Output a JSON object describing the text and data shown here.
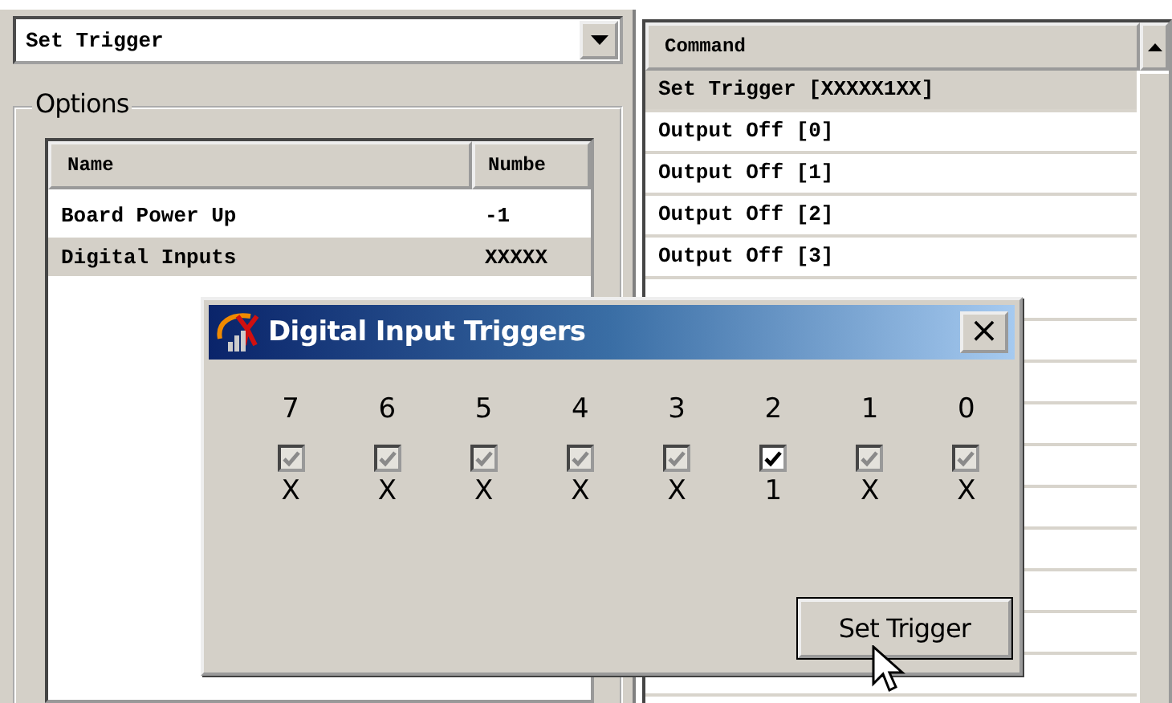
{
  "command_combo": {
    "value": "Set Trigger"
  },
  "options": {
    "title": "Options",
    "columns": [
      "Name",
      "Numbe"
    ],
    "rows": [
      {
        "name": "Board Power Up",
        "number": "-1",
        "selected": false
      },
      {
        "name": "Digital Inputs",
        "number": "XXXXX",
        "selected": true
      }
    ]
  },
  "command_list": {
    "column": "Command",
    "rows": [
      {
        "text": "Set Trigger [XXXXX1XX]",
        "selected": true
      },
      {
        "text": "Output Off [0]",
        "selected": false
      },
      {
        "text": "Output Off [1]",
        "selected": false
      },
      {
        "text": "Output Off [2]",
        "selected": false
      },
      {
        "text": "Output Off [3]",
        "selected": false
      }
    ]
  },
  "dialog": {
    "title": "Digital Input Triggers",
    "close": "×",
    "bits": [
      {
        "label": "7",
        "checked": true,
        "disabled": true,
        "value": "X"
      },
      {
        "label": "6",
        "checked": true,
        "disabled": true,
        "value": "X"
      },
      {
        "label": "5",
        "checked": true,
        "disabled": true,
        "value": "X"
      },
      {
        "label": "4",
        "checked": true,
        "disabled": true,
        "value": "X"
      },
      {
        "label": "3",
        "checked": true,
        "disabled": true,
        "value": "X"
      },
      {
        "label": "2",
        "checked": true,
        "disabled": false,
        "value": "1"
      },
      {
        "label": "1",
        "checked": true,
        "disabled": true,
        "value": "X"
      },
      {
        "label": "0",
        "checked": true,
        "disabled": true,
        "value": "X"
      }
    ],
    "button": "Set Trigger"
  }
}
